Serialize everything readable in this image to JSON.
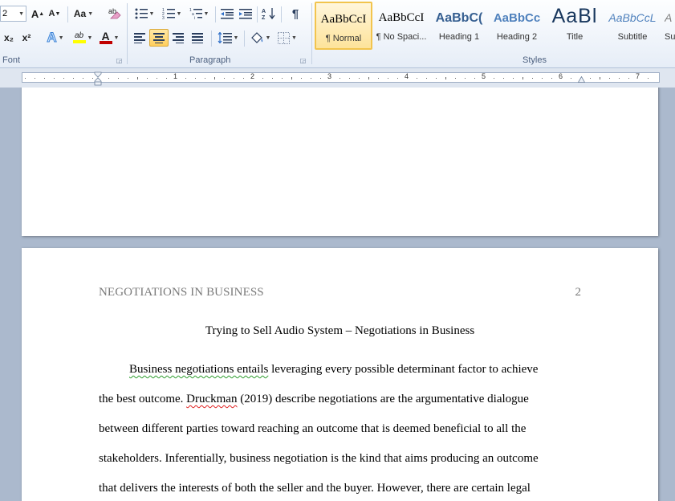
{
  "ribbon": {
    "font_group": {
      "label": "Font",
      "font_size": "2",
      "grow_font": "A",
      "shrink_font": "A",
      "change_case": "Aa",
      "subscript": "x₂",
      "superscript": "x²",
      "text_effects": "A",
      "highlight": "ab",
      "font_color": "A",
      "font_color_hex": "#c00000",
      "highlight_hex": "#ffff00"
    },
    "paragraph_group": {
      "label": "Paragraph",
      "pilcrow": "¶"
    },
    "styles_group": {
      "label": "Styles",
      "styles": [
        {
          "preview": "AaBbCcI",
          "name": "¶ Normal",
          "selected": true
        },
        {
          "preview": "AaBbCcI",
          "name": "¶ No Spaci...",
          "selected": false
        },
        {
          "preview": "AaBbC(",
          "name": "Heading 1",
          "selected": false
        },
        {
          "preview": "AaBbCc",
          "name": "Heading 2",
          "selected": false
        },
        {
          "preview": "AaBl",
          "name": "Title",
          "selected": false
        },
        {
          "preview": "AaBbCcL",
          "name": "Subtitle",
          "selected": false
        },
        {
          "preview": "A",
          "name": "Su",
          "selected": false
        }
      ]
    }
  },
  "ruler": {
    "numbers": [
      "1",
      "2",
      "3",
      "4",
      "5",
      "6",
      "7"
    ]
  },
  "document": {
    "running_head": "NEGOTIATIONS IN BUSINESS",
    "page_number": "2",
    "title": "Trying to Sell Audio System – Negotiations in Business",
    "lines": [
      {
        "segments": [
          {
            "text": "Business negotiations entails",
            "mark": "grammar"
          },
          {
            "text": " leveraging  every possible  determinant factor to achieve",
            "mark": ""
          }
        ]
      },
      {
        "segments": [
          {
            "text": "the best outcome. ",
            "mark": ""
          },
          {
            "text": "Druckman",
            "mark": "spelling"
          },
          {
            "text": " (2019) describe negotiations are the argumentative dialogue",
            "mark": ""
          }
        ]
      },
      {
        "segments": [
          {
            "text": "between different parties toward reaching an outcome that is  deemed beneficial to all  the",
            "mark": ""
          }
        ]
      },
      {
        "segments": [
          {
            "text": "stakeholders. Inferentially, business negotiation is the kind that aims producing an outcome",
            "mark": ""
          }
        ]
      },
      {
        "segments": [
          {
            "text": "that delivers the interests of both the seller and the buyer.  However, there are certain legal",
            "mark": ""
          }
        ]
      }
    ]
  }
}
